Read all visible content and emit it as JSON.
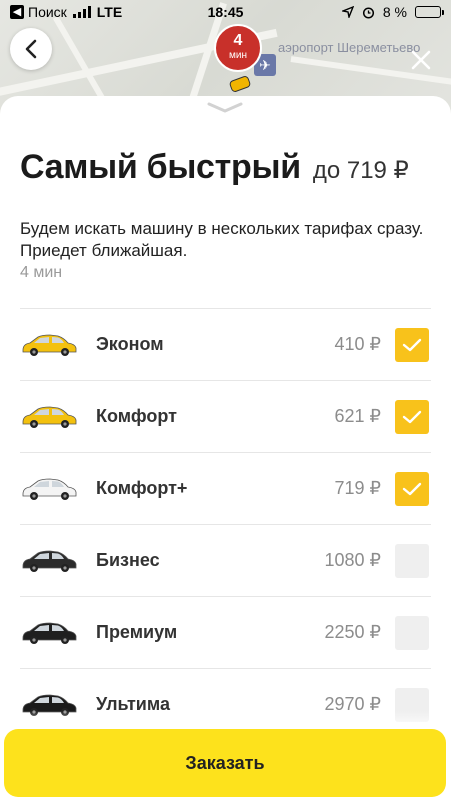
{
  "status_bar": {
    "back_app": "Поиск",
    "network": "LTE",
    "time": "18:45",
    "battery": "8 %"
  },
  "map": {
    "eta_number": "4",
    "eta_unit": "мин",
    "place_label": "аэропорт Шереметьево"
  },
  "sheet": {
    "title": "Самый быстрый",
    "price_upto": "до 719 ₽",
    "description": "Будем искать машину в нескольких тарифах сразу. Приедет ближайшая.",
    "eta": "4 мин"
  },
  "tariffs": [
    {
      "name": "Эконом",
      "price": "410 ₽",
      "checked": true,
      "car_color": "#f3c10e"
    },
    {
      "name": "Комфорт",
      "price": "621 ₽",
      "checked": true,
      "car_color": "#f3c10e"
    },
    {
      "name": "Комфорт+",
      "price": "719 ₽",
      "checked": true,
      "car_color": "#f4f4f4"
    },
    {
      "name": "Бизнес",
      "price": "1080 ₽",
      "checked": false,
      "car_color": "#2b2b2b"
    },
    {
      "name": "Премиум",
      "price": "2250 ₽",
      "checked": false,
      "car_color": "#1f1f1f"
    },
    {
      "name": "Ультима",
      "price": "2970 ₽",
      "checked": false,
      "car_color": "#1a1a1a"
    }
  ],
  "order_button": "Заказать",
  "colors": {
    "accent_yellow": "#fde21c",
    "checkbox_on": "#f8c21b",
    "eta_badge": "#c8302a"
  }
}
